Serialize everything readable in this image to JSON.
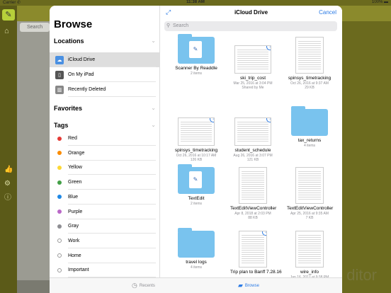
{
  "status_bar": {
    "carrier": "Carrier ✆",
    "time": "11:38 AM",
    "battery": "100% ▬"
  },
  "background": {
    "search_placeholder": "Search",
    "editor_text": "ditor"
  },
  "sidebar": {
    "title": "Browse",
    "locations_header": "Locations",
    "locations": [
      {
        "label": "iCloud Drive",
        "icon": "cloud-icon",
        "active": true
      },
      {
        "label": "On My iPad",
        "icon": "ipad-icon",
        "active": false
      },
      {
        "label": "Recently Deleted",
        "icon": "trash-icon",
        "active": false
      }
    ],
    "favorites_header": "Favorites",
    "tags_header": "Tags",
    "tags": [
      {
        "label": "Red",
        "color": "#e53935"
      },
      {
        "label": "Orange",
        "color": "#fb8c00"
      },
      {
        "label": "Yellow",
        "color": "#fdd835"
      },
      {
        "label": "Green",
        "color": "#43a047"
      },
      {
        "label": "Blue",
        "color": "#1e88e5"
      },
      {
        "label": "Purple",
        "color": "#ba68c8"
      },
      {
        "label": "Gray",
        "color": "#8e8e93"
      },
      {
        "label": "Work",
        "color": ""
      },
      {
        "label": "Home",
        "color": ""
      },
      {
        "label": "Important",
        "color": ""
      }
    ]
  },
  "main": {
    "title": "iCloud Drive",
    "cancel_label": "Cancel",
    "search_placeholder": "Search",
    "files": [
      {
        "name": "Scanner By Readdle",
        "meta": "2 items",
        "kind": "folder-app"
      },
      {
        "name": "ski_trip_cost",
        "meta": "Mar 25, 2016 at 3:04 PM\nShared by Me",
        "kind": "doc-wide",
        "cloud": true
      },
      {
        "name": "spinsys_timetracking",
        "meta": "Oct 26, 2016 at 9:37 AM\n29 KB",
        "kind": "doc"
      },
      {
        "name": "spinsys_timetracking",
        "meta": "Oct 26, 2016 at 10:17 AM\n126 KB",
        "kind": "doc-wide",
        "cloud": true
      },
      {
        "name": "student_schedule",
        "meta": "Aug 26, 2016 at 3:07 PM\n121 KB",
        "kind": "doc-wide",
        "cloud": true
      },
      {
        "name": "tax_returns",
        "meta": "4 items",
        "kind": "folder"
      },
      {
        "name": "TextEdit",
        "meta": "2 items",
        "kind": "folder-app"
      },
      {
        "name": "TextEditViewController",
        "meta": "Apr 8, 2018 at 2:03 PM\n88 KB",
        "kind": "doc"
      },
      {
        "name": "TextEditViewController",
        "meta": "Apr 25, 2016 at 9:35 AM\n7 KB",
        "kind": "doc"
      },
      {
        "name": "travel logs",
        "meta": "4 items",
        "kind": "folder"
      },
      {
        "name": "Trip plan to Banff 7.28.16",
        "meta": "",
        "kind": "doc",
        "cloud": true
      },
      {
        "name": "wire_info",
        "meta": "Jan 16, 2017 at 9:38 PM",
        "kind": "doc"
      }
    ]
  },
  "tabbar": {
    "recents_label": "Recents",
    "browse_label": "Browse"
  }
}
